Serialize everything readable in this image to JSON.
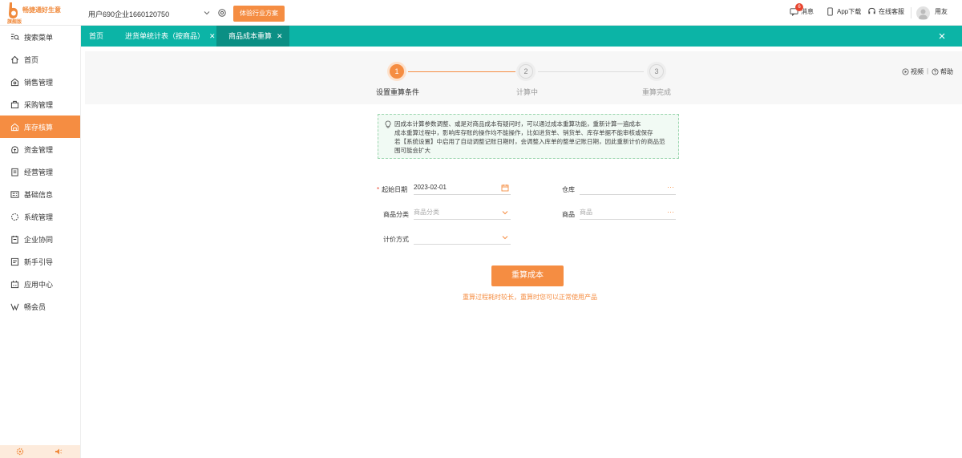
{
  "header": {
    "brand_name": "畅捷通好生意",
    "brand_edition": "旗舰版",
    "account": "用户690企业1660120750",
    "trial_button": "体验行业方案",
    "messages_label": "消息",
    "messages_count": "6",
    "app_download": "App下载",
    "online_service": "在线客服",
    "user_label": "用友"
  },
  "sidebar": {
    "items": [
      {
        "label": "搜索菜单",
        "icon": "search-menu-icon"
      },
      {
        "label": "首页",
        "icon": "home-icon"
      },
      {
        "label": "销售管理",
        "icon": "sales-icon"
      },
      {
        "label": "采购管理",
        "icon": "purchase-icon"
      },
      {
        "label": "库存核算",
        "icon": "inventory-icon"
      },
      {
        "label": "资金管理",
        "icon": "money-icon"
      },
      {
        "label": "经营管理",
        "icon": "operations-icon"
      },
      {
        "label": "基础信息",
        "icon": "basic-info-icon"
      },
      {
        "label": "系统管理",
        "icon": "system-icon"
      },
      {
        "label": "企业协同",
        "icon": "collab-icon"
      },
      {
        "label": "新手引导",
        "icon": "guide-icon"
      },
      {
        "label": "应用中心",
        "icon": "app-center-icon"
      },
      {
        "label": "畅会员",
        "icon": "member-icon"
      }
    ],
    "active_index": 4
  },
  "tabs": [
    {
      "label": "首页"
    },
    {
      "label": "进货单统计表（按商品）"
    },
    {
      "label": "商品成本重算"
    }
  ],
  "steps": [
    {
      "num": "1",
      "label": "设置重算条件"
    },
    {
      "num": "2",
      "label": "计算中"
    },
    {
      "num": "3",
      "label": "重算完成"
    }
  ],
  "help": {
    "video": "视频",
    "help": "帮助"
  },
  "notice": {
    "line1": "因成本计算参数调整、或是对商品成本有疑问时，可以通过成本重算功能，重新计算一遍成本",
    "line2": "成本重算过程中，影响库存账的操作均不能操作，比如进货单、销货单、库存单据不能审核或保存",
    "line3": "若【系统设置】中启用了自动调整记账日期时，会调整入库单的整单记账日期，因此重新计价的商品范",
    "line4": "围可能会扩大"
  },
  "form": {
    "start_date_label": "起始日期",
    "start_date_value": "2023-02-01",
    "warehouse_label": "仓库",
    "category_label": "商品分类",
    "category_placeholder": "商品分类",
    "product_label": "商品",
    "product_placeholder": "商品",
    "pricing_label": "计价方式"
  },
  "action": {
    "recalc_button": "重算成本",
    "hint": "重算过程耗时较长，重算时您可以正常使用产品"
  },
  "colors": {
    "accent": "#f58d42",
    "tabbar": "#0cb4a6",
    "tab_active": "#0b8f84"
  }
}
